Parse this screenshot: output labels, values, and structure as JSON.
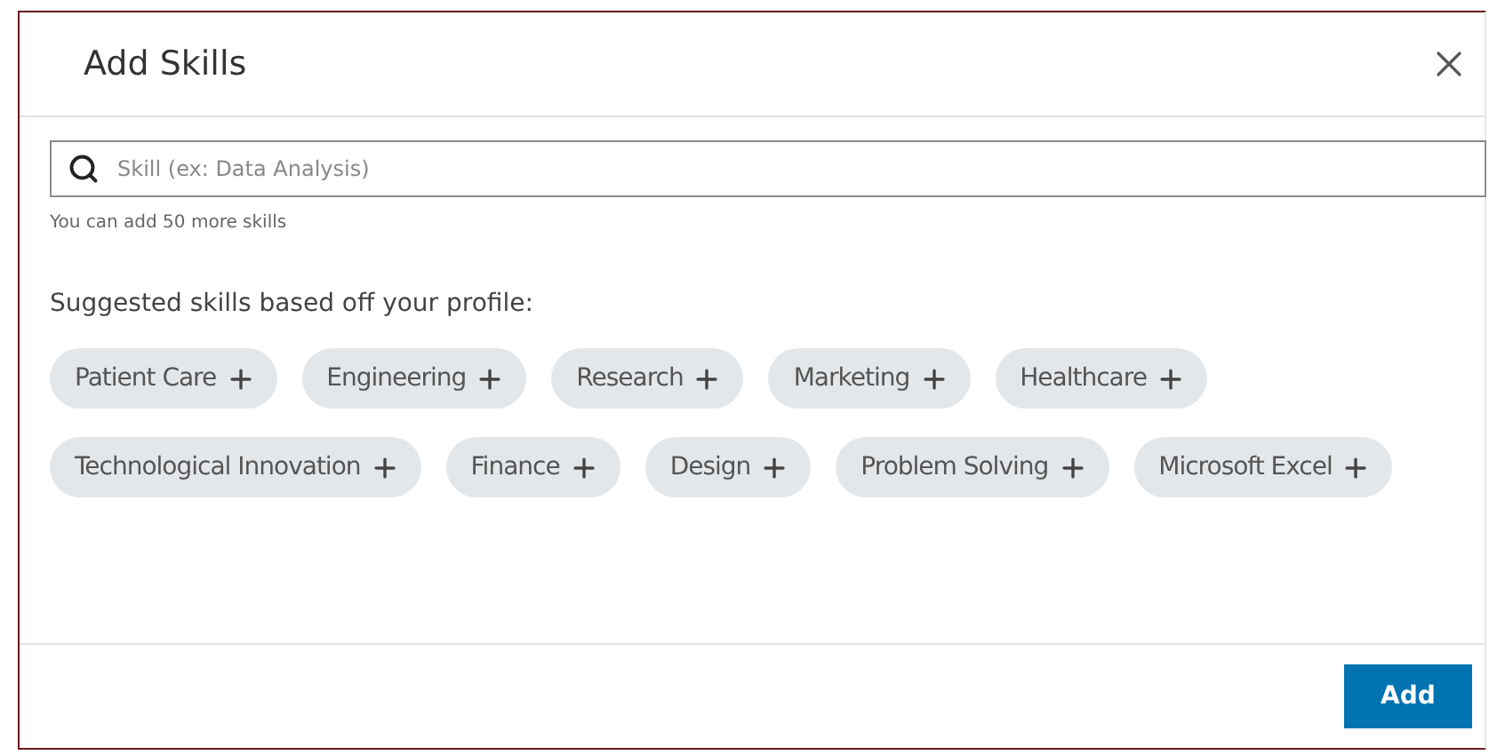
{
  "dialog": {
    "title": "Add Skills"
  },
  "search": {
    "placeholder": "Skill (ex: Data Analysis)",
    "hint": "You can add 50 more skills"
  },
  "suggestions": {
    "label": "Suggested skills based off your profile:",
    "skills": [
      "Patient Care",
      "Engineering",
      "Research",
      "Marketing",
      "Healthcare",
      "Technological Innovation",
      "Finance",
      "Design",
      "Problem Solving",
      "Microsoft Excel"
    ]
  },
  "footer": {
    "button": "Add"
  }
}
